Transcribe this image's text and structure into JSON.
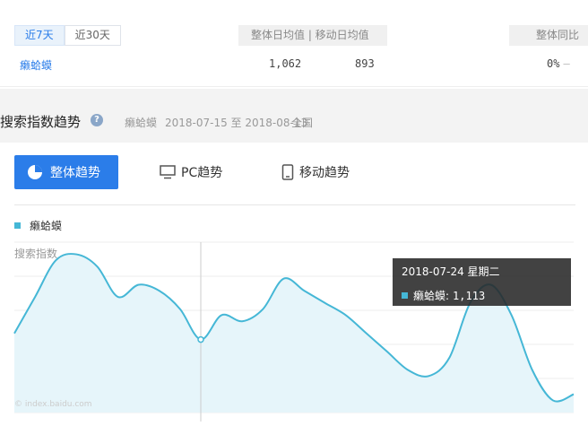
{
  "range_tabs": [
    "近7天",
    "近30天"
  ],
  "summary": {
    "header_avg": "整体日均值 | 移动日均值",
    "header_yoy": "整体同比",
    "keyword": "癞蛤蟆",
    "overall_avg": "1,062",
    "mobile_avg": "893",
    "yoy": "0%"
  },
  "section": {
    "title": "搜索指数趋势",
    "keyword": "癞蛤蟆",
    "date_range": "2018-07-15 至 2018-08-13",
    "region": "全国"
  },
  "tabs": {
    "overall": "整体趋势",
    "pc": "PC趋势",
    "mobile": "移动趋势"
  },
  "legend": "癞蛤蟆",
  "y_axis_label": "搜索指数",
  "watermark": "© index.baidu.com",
  "tooltip": {
    "date": "2018-07-24 星期二",
    "series": "癞蛤蟆:",
    "value": "1,113"
  },
  "colors": {
    "accent": "#2b7de9",
    "series": "#45b7d6",
    "area": "#e6f5fa"
  },
  "chart_data": {
    "type": "area",
    "series": [
      {
        "name": "癞蛤蟆",
        "values": [
          1030,
          1090,
          1150,
          1160,
          1140,
          1090,
          1110,
          1100,
          1070,
          1020,
          1060,
          1050,
          1070,
          1120,
          1100,
          1080,
          1060,
          1030,
          1000,
          970,
          960,
          990,
          1080,
          1110,
          1060,
          970,
          920,
          930
        ]
      }
    ],
    "highlight_index": 9
  }
}
